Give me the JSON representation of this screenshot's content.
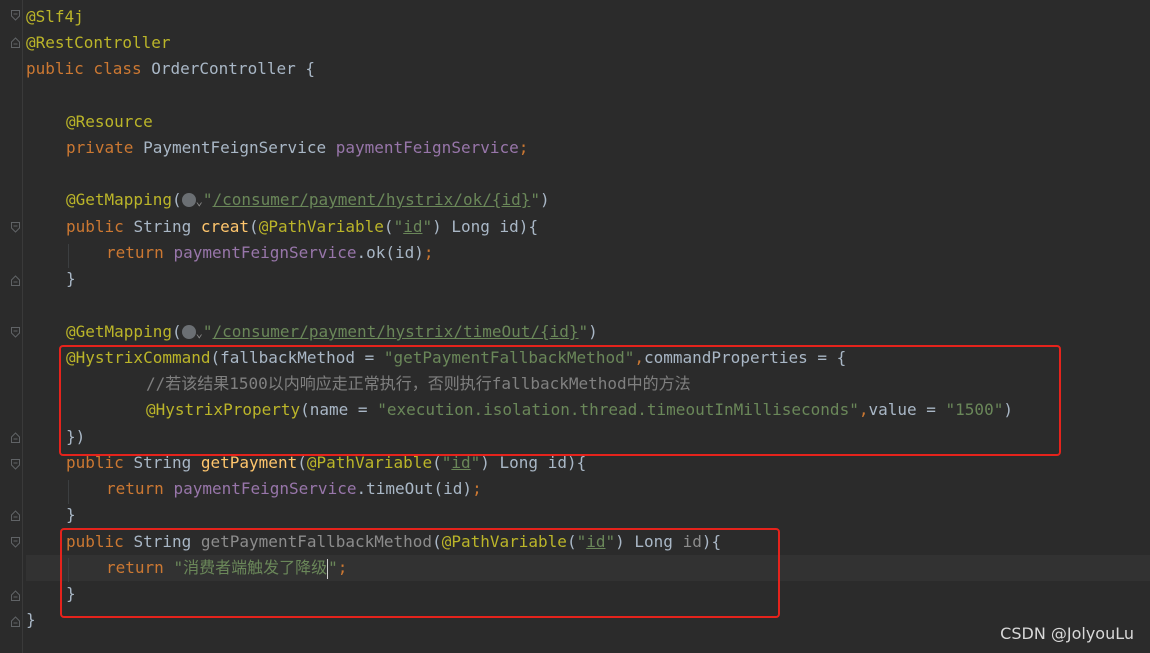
{
  "watermark": "CSDN @JolyouLu",
  "code": {
    "l1_ann": "@Slf4j",
    "l2_ann": "@RestController",
    "l3_kw": "public class ",
    "l3_name": "OrderController {",
    "l5_ann": "@Resource",
    "l6_kw": "private ",
    "l6_type": "PaymentFeignService ",
    "l6_field": "paymentFeignService",
    "l6_semi": ";",
    "l8_ann": "@GetMapping",
    "l8_open": "(",
    "l8_chev": "⌄",
    "l8_q1": "\"",
    "l8_path": "/consumer/payment/hystrix/ok/{id}",
    "l8_q2": "\"",
    "l8_close": ")",
    "l9_kw": "public ",
    "l9_type": "String ",
    "l9_fn": "creat",
    "l9_p1": "(",
    "l9_ann": "@PathVariable",
    "l9_p2": "(",
    "l9_q1": "\"",
    "l9_id": "id",
    "l9_q2": "\"",
    "l9_rest": ") Long id){",
    "l10_kw": "return ",
    "l10_field": "paymentFeignService",
    "l10_rest": ".ok(id)",
    "l10_semi": ";",
    "l11": "}",
    "l13_ann": "@GetMapping",
    "l13_open": "(",
    "l13_chev": "⌄",
    "l13_q1": "\"",
    "l13_path": "/consumer/payment/hystrix/timeOut/{id}",
    "l13_q2": "\"",
    "l13_close": ")",
    "l14_ann": "@HystrixCommand",
    "l14_a": "(fallbackMethod = ",
    "l14_str": "\"getPaymentFallbackMethod\"",
    "l14_comma": ",",
    "l14_b": "commandProperties = {",
    "l15_cmt": "//若该结果1500以内响应走正常执行，否则执行fallbackMethod中的方法",
    "l16_ann": "@HystrixProperty",
    "l16_a": "(name = ",
    "l16_str": "\"execution.isolation.thread.timeoutInMilliseconds\"",
    "l16_comma": ",",
    "l16_b": "value = ",
    "l16_str2": "\"1500\"",
    "l16_c": ")",
    "l17": "})",
    "l18_kw": "public ",
    "l18_type": "String ",
    "l18_fn": "getPayment",
    "l18_p1": "(",
    "l18_ann": "@PathVariable",
    "l18_p2": "(",
    "l18_q1": "\"",
    "l18_id": "id",
    "l18_q2": "\"",
    "l18_rest": ") Long id){",
    "l19_kw": "return ",
    "l19_field": "paymentFeignService",
    "l19_rest": ".timeOut(id)",
    "l19_semi": ";",
    "l20": "}",
    "l21_kw": "public ",
    "l21_type": "String ",
    "l21_fn": "getPaymentFallbackMethod",
    "l21_p1": "(",
    "l21_ann": "@PathVariable",
    "l21_p2": "(",
    "l21_q1": "\"",
    "l21_id": "id",
    "l21_q2": "\"",
    "l21_long": ") Long ",
    "l21_param": "id",
    "l21_end": "){",
    "l22_kw": "return ",
    "l22_str": "\"消费者端触发了降级",
    "l22_str2": "\"",
    "l22_semi": ";",
    "l23": "}",
    "l24": "}"
  }
}
